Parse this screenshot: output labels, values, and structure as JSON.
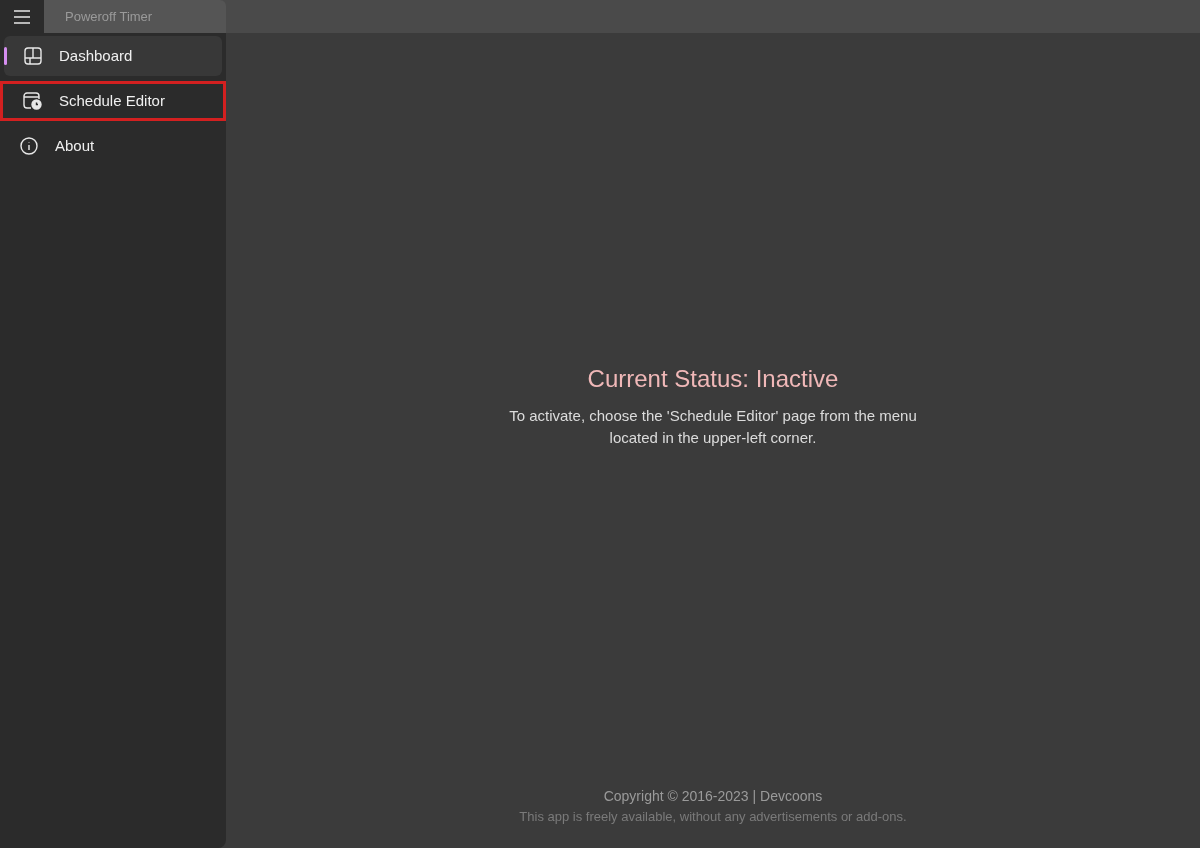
{
  "window": {
    "title": "Poweroff Timer"
  },
  "sidebar": {
    "items": [
      {
        "label": "Dashboard",
        "selected": true,
        "highlighted": false
      },
      {
        "label": "Schedule Editor",
        "selected": false,
        "highlighted": true
      },
      {
        "label": "About",
        "selected": false,
        "highlighted": false
      }
    ]
  },
  "status": {
    "title": "Current Status: Inactive",
    "message": "To activate, choose the 'Schedule Editor' page from the menu located in the upper-left corner."
  },
  "footer": {
    "copyright": "Copyright © 2016-2023 | Devcoons",
    "note": "This app is freely available, without any advertisements or add-ons."
  }
}
